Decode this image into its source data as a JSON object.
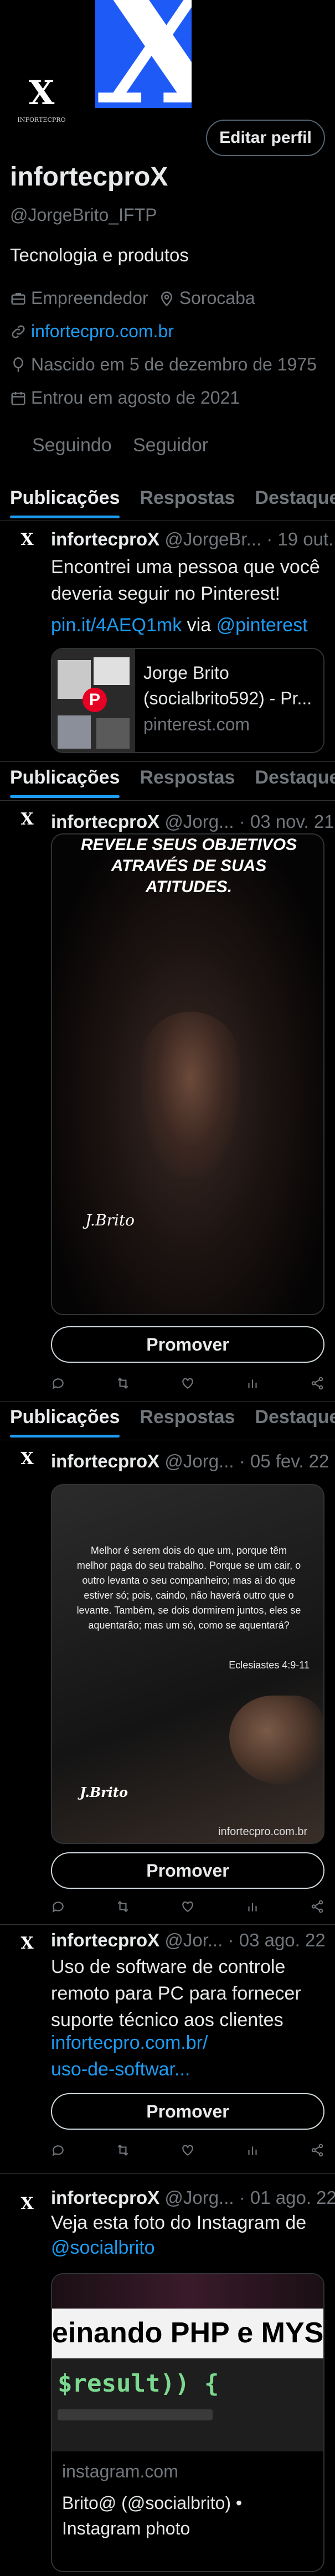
{
  "profile": {
    "display_name": "infortecproX",
    "handle": "@JorgeBrito_IFTP",
    "bio": "Tecnologia e produtos",
    "category": "Empreendedor",
    "location": "Sorocaba",
    "website": "infortecpro.com.br",
    "birth": "Nascido em 5 de dezembro de 1975",
    "joined": "Entrou em agosto de 2021",
    "following_label": "Seguindo",
    "followers_label": "Seguidor",
    "edit_button": "Editar perfil",
    "logo_letter": "X",
    "logo_caption": "INFORTECPRO"
  },
  "tabs": [
    "Publicações",
    "Respostas",
    "Destaques"
  ],
  "posts": [
    {
      "name": "infortecproX",
      "meta": "@JorgeBr... · 19 out.",
      "text": "Encontrei uma pessoa que você deveria seguir no Pinterest!",
      "link": "pin.it/4AEQ1mk",
      "via": "via",
      "via_handle": "@pinterest",
      "card_title": "Jorge Brito (socialbrito592) - Pr...",
      "card_domain": "pinterest.com"
    },
    {
      "name": "infortecproX",
      "meta": "@Jorg... · 03 nov. 21",
      "image_text": "REVELE SEUS OBJETIVOS ATRAVÉS DE SUAS ATITUDES.",
      "signature": "J.Brito",
      "promote": "Promover"
    },
    {
      "name": "infortecproX",
      "meta": "@Jorg... · 05 fev. 22",
      "verse": "Melhor é serem dois do que um, porque têm melhor paga do seu trabalho. Porque se um cair, o outro levanta o seu companheiro; mas ai do que estiver só; pois, caindo, não haverá outro que o levante. Também, se dois dormirem juntos, eles se aquentarão; mas um só, como se aquentará?",
      "reference": "Eclesiastes 4:9-11",
      "signature": "J.Brito",
      "site": "infortecpro.com.br",
      "promote": "Promover"
    },
    {
      "name": "infortecproX",
      "meta": "@Jor... · 03 ago. 22",
      "text": "Uso de software de controle remoto para PC para fornecer suporte técnico aos clientes",
      "link1": "infortecpro.com.br/",
      "link2": "uso-de-softwar...",
      "promote": "Promover"
    },
    {
      "name": "infortecproX",
      "meta": "@Jorg... · 01 ago. 22",
      "text": "Veja esta foto do Instagram de",
      "link": "@socialbrito",
      "image_text": "einando PHP e MYSQ",
      "code_text": "$result)) {",
      "card_domain": "instagram.com",
      "card_title": "Brito@ (@socialbrito) • Instagram photo"
    }
  ]
}
